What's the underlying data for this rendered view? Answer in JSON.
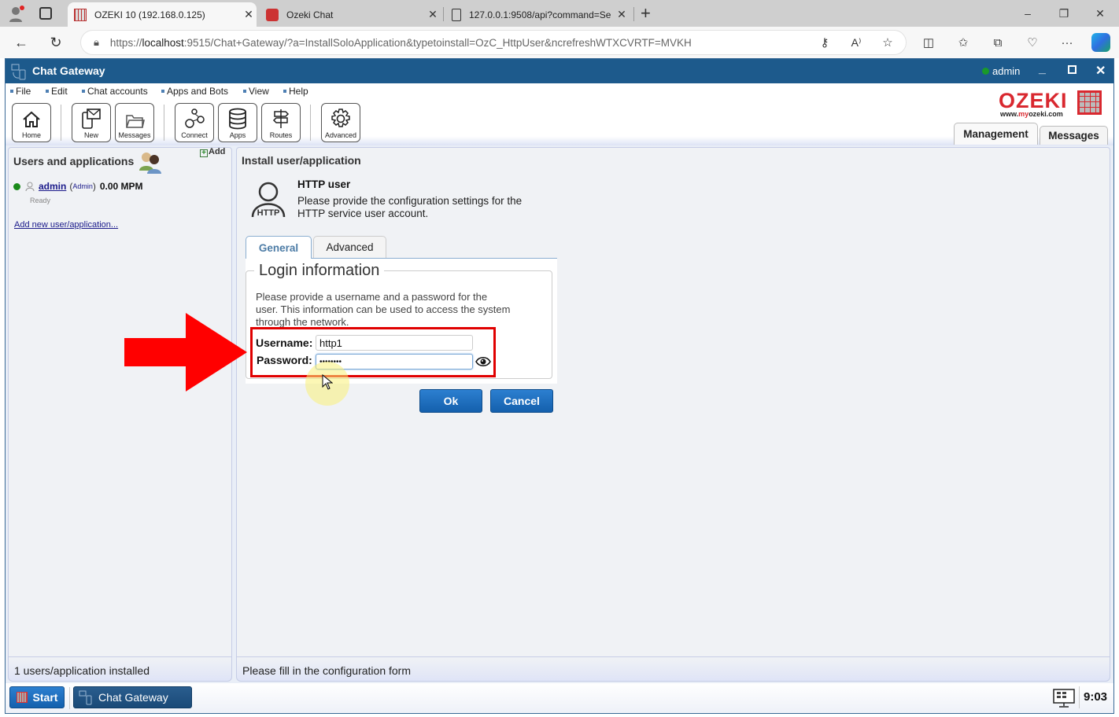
{
  "browser": {
    "tabs": [
      {
        "title": "OZEKI 10 (192.168.0.125)",
        "active": true,
        "icon": "ozeki-grid-icon"
      },
      {
        "title": "Ozeki Chat",
        "active": false,
        "icon": "ozeki-chat-icon"
      },
      {
        "title": "127.0.0.1:9508/api?command=Se",
        "active": false,
        "icon": "document-icon"
      }
    ],
    "new_tab": "+",
    "window_controls": {
      "minimize": "–",
      "restore": "❐",
      "close": "✕"
    },
    "url_prefix": "https://",
    "url_host": "localhost",
    "url_rest": ":9515/Chat+Gateway/?a=InstallSoloApplication&typetoinstall=OzC_HttpUser&ncrefreshWTXCVRTF=MVKH"
  },
  "app": {
    "title": "Chat Gateway",
    "user": "admin",
    "user_status_color": "#1a9a2a",
    "menu": [
      "File",
      "Edit",
      "Chat accounts",
      "Apps and Bots",
      "View",
      "Help"
    ],
    "toolbar": [
      {
        "label": "Home",
        "icon": "home-icon"
      },
      {
        "label": "New",
        "icon": "new-message-icon"
      },
      {
        "label": "Messages",
        "icon": "folder-icon"
      },
      {
        "label": "Connect",
        "icon": "connect-icon"
      },
      {
        "label": "Apps",
        "icon": "database-icon"
      },
      {
        "label": "Routes",
        "icon": "routes-icon"
      },
      {
        "label": "Advanced",
        "icon": "gear-icon"
      }
    ],
    "logo": {
      "text": "OZEKI",
      "sub_prefix": "www.",
      "sub_accent": "my",
      "sub_suffix": "ozeki.com"
    },
    "main_tabs": [
      "Management",
      "Messages"
    ],
    "accent": "#1d5a8c"
  },
  "left_panel": {
    "title": "Users and applications",
    "add_label": "Add",
    "users": [
      {
        "name": "admin",
        "role": "Admin",
        "rate": "0.00 MPM",
        "status": "Ready",
        "online": true
      }
    ],
    "add_link": "Add new user/application...",
    "status": "1 users/application installed"
  },
  "right_panel": {
    "title": "Install user/application",
    "app_name": "HTTP user",
    "app_icon_label": "HTTP",
    "app_desc_1": "Please provide the configuration settings for the",
    "app_desc_2": "HTTP service user account.",
    "tabs": [
      "General",
      "Advanced"
    ],
    "active_tab": "General",
    "fieldset_title": "Login information",
    "fieldset_desc_1": "Please provide a username and a password for the",
    "fieldset_desc_2": "user. This information can be used to access the system",
    "fieldset_desc_3": "through the network.",
    "username_label": "Username:",
    "username_value": "http1",
    "password_label": "Password:",
    "password_value": "••••••••",
    "ok_label": "Ok",
    "cancel_label": "Cancel",
    "status": "Please fill in the configuration form"
  },
  "taskbar": {
    "start_label": "Start",
    "app_label": "Chat Gateway",
    "clock": "9:03"
  },
  "annotation": {
    "arrow_color": "#ff0000",
    "highlight_color": "#e00000"
  }
}
